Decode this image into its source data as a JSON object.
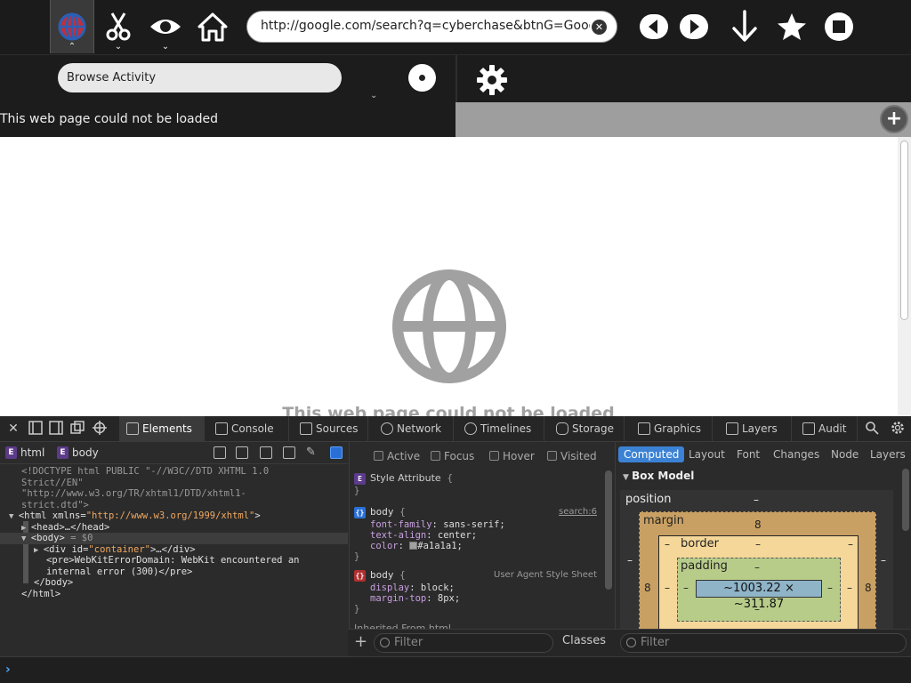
{
  "toolbar": {
    "url": "http://google.com/search?q=cyberchase&btnG=Google+",
    "url_clear_label": "✕"
  },
  "subbar": {
    "activity_label": "Browse Activity"
  },
  "error_strip": {
    "text": "This web page could not be loaded"
  },
  "page": {
    "message": "This web page could not be loaded"
  },
  "inspector": {
    "tabs": [
      "Elements",
      "Console",
      "Sources",
      "Network",
      "Timelines",
      "Storage",
      "Graphics",
      "Layers",
      "Audit"
    ],
    "breadcrumbs": [
      "html",
      "body"
    ],
    "dom": {
      "doctype_1": "<!DOCTYPE html PUBLIC \"-//W3C//DTD XHTML 1.0",
      "doctype_2": "Strict//EN\"",
      "doctype_3": "\"http://www.w3.org/TR/xhtml1/DTD/xhtml1-",
      "doctype_4": "strict.dtd\">",
      "html_open": "<html xmlns=",
      "html_ns": "\"http://www.w3.org/1999/xhtml\"",
      "html_close_bracket": ">",
      "head": "<head>…</head>",
      "body": "<body>",
      "body_ref": " = $0",
      "div_open": "<div id=",
      "div_id": "\"container\"",
      "div_rest": ">…</div>",
      "pre_1": "<pre>WebKitErrorDomain: WebKit encountered an",
      "pre_2": "internal error (300)</pre>",
      "body_close": "</body>",
      "html_close": "</html>"
    },
    "pseudo_classes": [
      "Active",
      "Focus",
      "Hover",
      "Visited"
    ],
    "rules": {
      "style_attribute": "Style Attribute",
      "rule1_selector": "body",
      "rule1_source": "search:6",
      "rule1_props": [
        {
          "name": "font-family",
          "value": "sans-serif;"
        },
        {
          "name": "text-align",
          "value": "center;"
        },
        {
          "name": "color",
          "value": "#a1a1a1;"
        }
      ],
      "rule2_selector": "body",
      "rule2_source": "User Agent Style Sheet",
      "rule2_props": [
        {
          "name": "display",
          "value": "block;"
        },
        {
          "name": "margin-top",
          "value": "8px;"
        }
      ],
      "inherited": "Inherited From html"
    },
    "computed_tabs": [
      "Computed",
      "Layout",
      "Font",
      "Changes",
      "Node",
      "Layers"
    ],
    "box_model": {
      "title": "Box Model",
      "position_label": "position",
      "position_value": "–",
      "margin_label": "margin",
      "margin_top": "8",
      "margin_left": "8",
      "margin_right": "8",
      "border_label": "border",
      "border_top": "–",
      "border_side": "–",
      "padding_label": "padding",
      "padding_top": "–",
      "padding_bottom": "–",
      "padding_side": "–",
      "content": "~1003.22 × ~311.87"
    },
    "filter_placeholder": "Filter",
    "classes_label": "Classes",
    "computed_filter_placeholder": "Filter"
  },
  "colors": {
    "accent": "#3b82d4",
    "page_message": "#a1a1a1",
    "selection": "#2a6fd6"
  }
}
